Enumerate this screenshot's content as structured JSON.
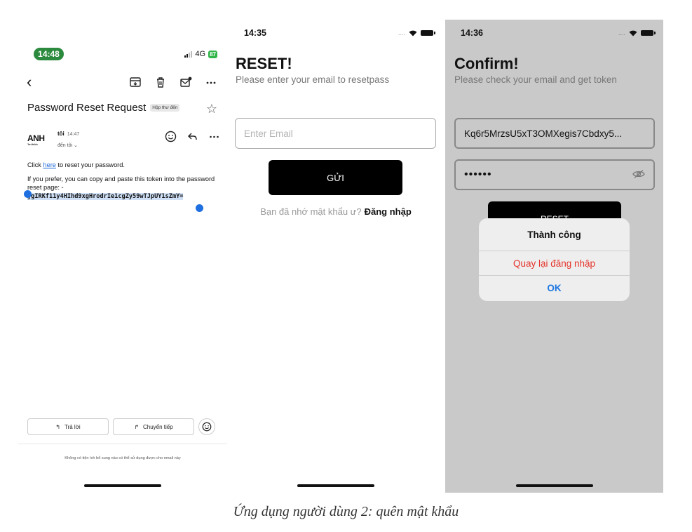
{
  "screen_mail": {
    "status": {
      "time": "14:48",
      "network": "4G",
      "battery": "87"
    },
    "subject": "Password Reset Request",
    "inbox_badge": "Hộp thư đến",
    "sender": {
      "name": "tôi",
      "time": "14:47",
      "to": "đến tôi ⌄",
      "avatar_text": "ANH",
      "avatar_sub": "Tran Viet Anh"
    },
    "body": {
      "click": "Click ",
      "link": "here",
      "click_rest": " to reset your password.",
      "prefer": "If you prefer, you can copy and paste this token into the password reset page: -",
      "token": "jgIRKf11y4HIhd9xgHrodrIe1cgZy59wTJpUY1sZmY="
    },
    "reply_label": "Trả lời",
    "forward_label": "Chuyển tiếp",
    "footer_note": "Không có tiện ích bổ sung nào có thể sử dụng được cho email này"
  },
  "screen_reset": {
    "status": {
      "time": "14:35"
    },
    "title": "RESET!",
    "subtitle": "Please enter your email to resetpass",
    "email_placeholder": "Enter Email",
    "send_label": "GỬI",
    "remember_text": "Bạn đã nhớ mật khẩu ư?",
    "login_link": "Đăng nhập"
  },
  "screen_confirm": {
    "status": {
      "time": "14:36"
    },
    "title": "Confirm!",
    "subtitle": "Please check your email and get token",
    "token_value": "Kq6r5MrzsU5xT3OMXegis7Cbdxy5...",
    "password_value": "••••••",
    "reset_label": "RESET",
    "alert": {
      "title": "Thành công",
      "back_to_login": "Quay lại đăng nhập",
      "ok": "OK"
    }
  },
  "caption": "Ứng dụng người dùng 2: quên mật khẩu",
  "colors": {
    "mail_time_pill": "#2b8a3e",
    "link": "#1a66d6",
    "selection": "#cfe0f6",
    "alert_destructive": "#e5352c",
    "alert_ok": "#1d76e2"
  }
}
